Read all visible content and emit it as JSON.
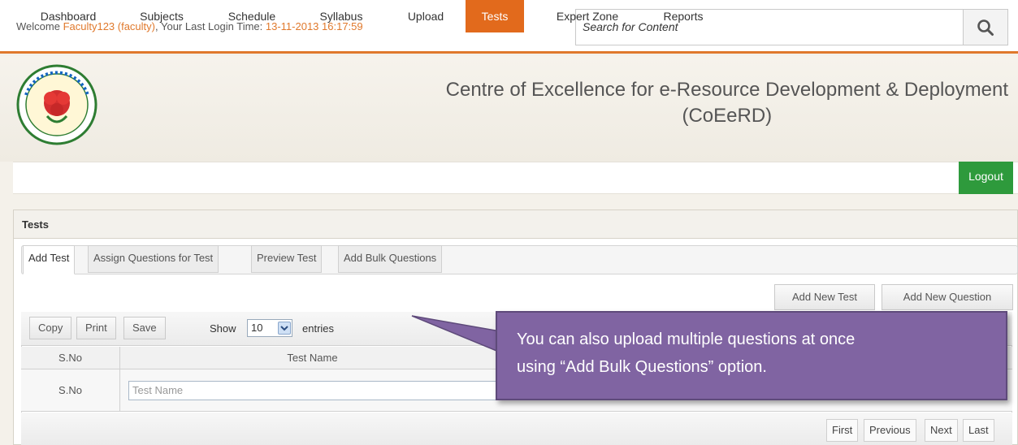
{
  "topbar": {
    "welcome_prefix": "Welcome ",
    "username": "Faculty123 (faculty)",
    "login_label": ", Your Last Login Time: ",
    "login_time": "13-11-2013 16:17:59",
    "search_placeholder": "Search for Content",
    "search_icon": "search-icon"
  },
  "header": {
    "title_line1": "Centre of Excellence for e-Resource Development & Deployment",
    "title_line2": "(CoEeRD)",
    "logo": "jntu-kakinada-seal"
  },
  "nav": {
    "items": [
      "Dashboard",
      "Subjects",
      "Schedule",
      "Syllabus",
      "Upload",
      "Tests",
      "Expert Zone",
      "Reports"
    ],
    "active": "Tests",
    "logout": "Logout"
  },
  "panel": {
    "title": "Tests",
    "tabs": [
      "Add Test",
      "Assign Questions for Test",
      "Preview Test",
      "Add Bulk Questions"
    ],
    "active_tab": "Add Test",
    "actions": {
      "add_test": "Add New Test",
      "add_question": "Add New Question"
    }
  },
  "table": {
    "tools": [
      "Copy",
      "Print",
      "Save"
    ],
    "show_label": "Show",
    "entries_value": "10",
    "entries_label": "entries",
    "columns": [
      "S.No",
      "Test Name"
    ],
    "filter": {
      "sno": "S.No",
      "test_name_placeholder": "Test Name"
    },
    "pager": [
      "First",
      "Previous",
      "Next",
      "Last"
    ]
  },
  "callout": {
    "line1": "You can also upload multiple questions at once",
    "line2": "using “Add Bulk Questions” option."
  },
  "colors": {
    "accent": "#e26a1c",
    "logout": "#2e9a3c",
    "callout": "#8064a2"
  }
}
